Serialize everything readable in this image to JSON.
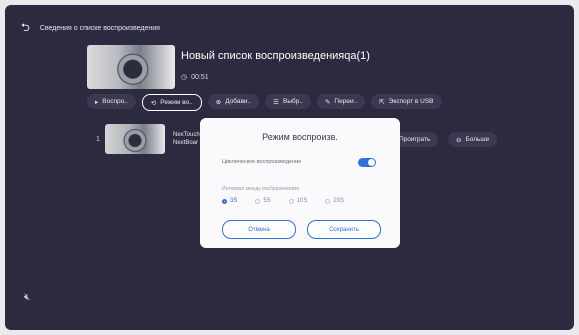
{
  "header": {
    "title": "Сведения о списке воспроизведения",
    "back_icon": "back-arrow-icon"
  },
  "playlist": {
    "title": "Новый список воспроизведенияqa(1)",
    "duration": "00:51"
  },
  "toolbar": {
    "items": [
      {
        "label": "Воспро..",
        "icon": "play-icon"
      },
      {
        "label": "Режим во..",
        "icon": "loop-mode-icon",
        "active": true
      },
      {
        "label": "Добави..",
        "icon": "add-icon"
      },
      {
        "label": "Выбр..",
        "icon": "list-select-icon"
      },
      {
        "label": "Переи..",
        "icon": "rename-icon"
      },
      {
        "label": "Экспорт в USB",
        "icon": "export-icon"
      }
    ]
  },
  "list": {
    "rows": [
      {
        "index": "1",
        "name_line1": "NexTouch",
        "name_line2": "NextBoar",
        "play_label": "Проиграть",
        "more_label": "Больше"
      }
    ]
  },
  "modal": {
    "title": "Режим воспроизв.",
    "loop_label": "Циклическое воспроизведение",
    "loop_enabled": true,
    "interval_label": "Интервал между изображениями",
    "interval_options": [
      "3S",
      "5S",
      "10S",
      "20S"
    ],
    "interval_selected": "3S",
    "cancel_label": "Отмена",
    "save_label": "Сохранить"
  },
  "colors": {
    "background": "#2b2a3f",
    "accent": "#2f6fde",
    "modal_bg": "#fafafc"
  }
}
